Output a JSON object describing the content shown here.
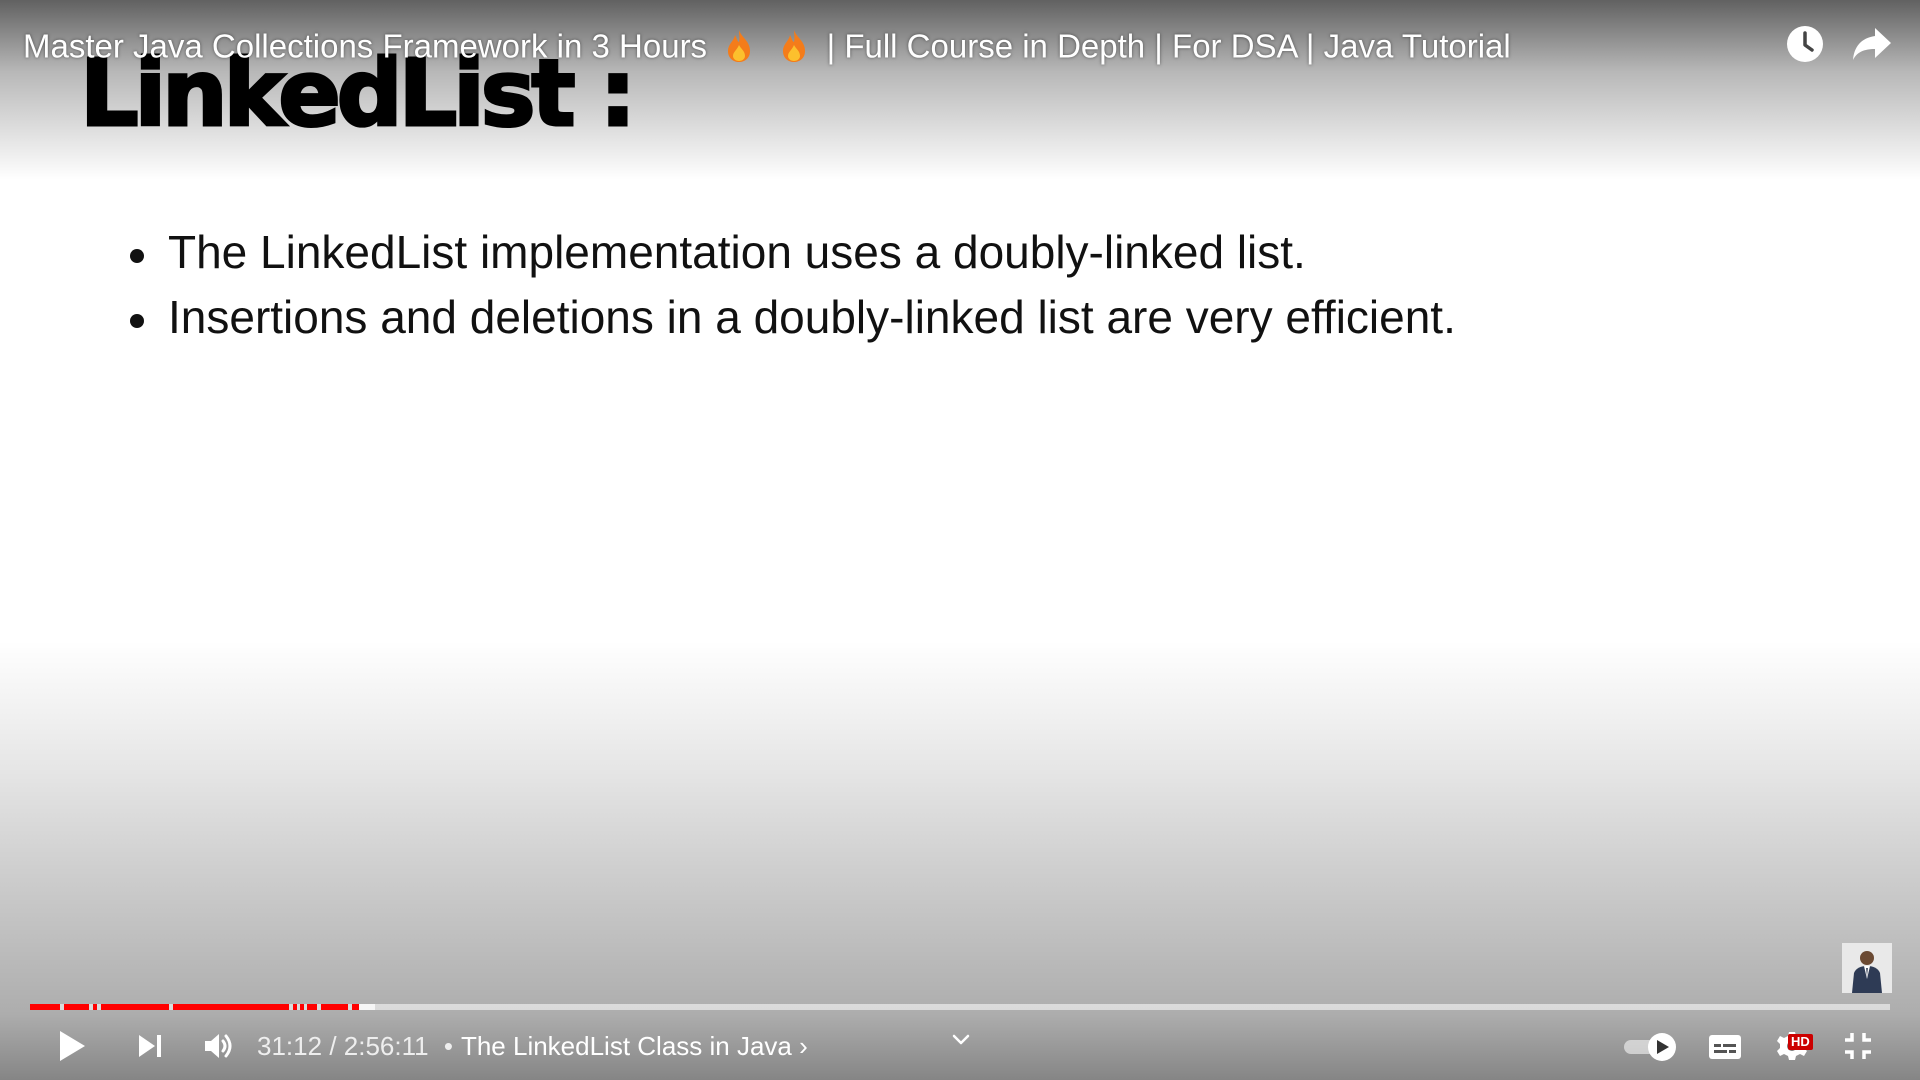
{
  "top_bar": {
    "title_part1": "Master Java Collections Framework in 3 Hours",
    "title_part2": "| Full Course in Depth | For DSA | Java Tutorial",
    "title_emoji": [
      "fire-icon",
      "fire-icon"
    ],
    "watch_later_icon": "clock-icon",
    "share_icon": "share-arrow-icon"
  },
  "slide": {
    "title": "LinkedList :",
    "bullets": [
      "The LinkedList implementation uses a doubly-linked list.",
      "Insertions and deletions in a doubly-linked list are very efficient."
    ]
  },
  "controls": {
    "current_time": "31:12",
    "separator": "/",
    "duration": "2:56:11",
    "chapter_dot": "•",
    "chapter": "The LinkedList Class in Java",
    "chapter_chevron": "›",
    "hd_badge": "HD",
    "progress_fraction": 0.177,
    "icons": [
      "play-icon",
      "next-icon",
      "volume-icon",
      "chevron-down-icon",
      "autoplay-toggle-icon",
      "subtitles-icon",
      "settings-gear-icon",
      "exit-fullscreen-icon"
    ]
  },
  "colors": {
    "progress_played": "#ff0000",
    "hd_badge": "#cc0000",
    "control_text": "#ffffff"
  }
}
